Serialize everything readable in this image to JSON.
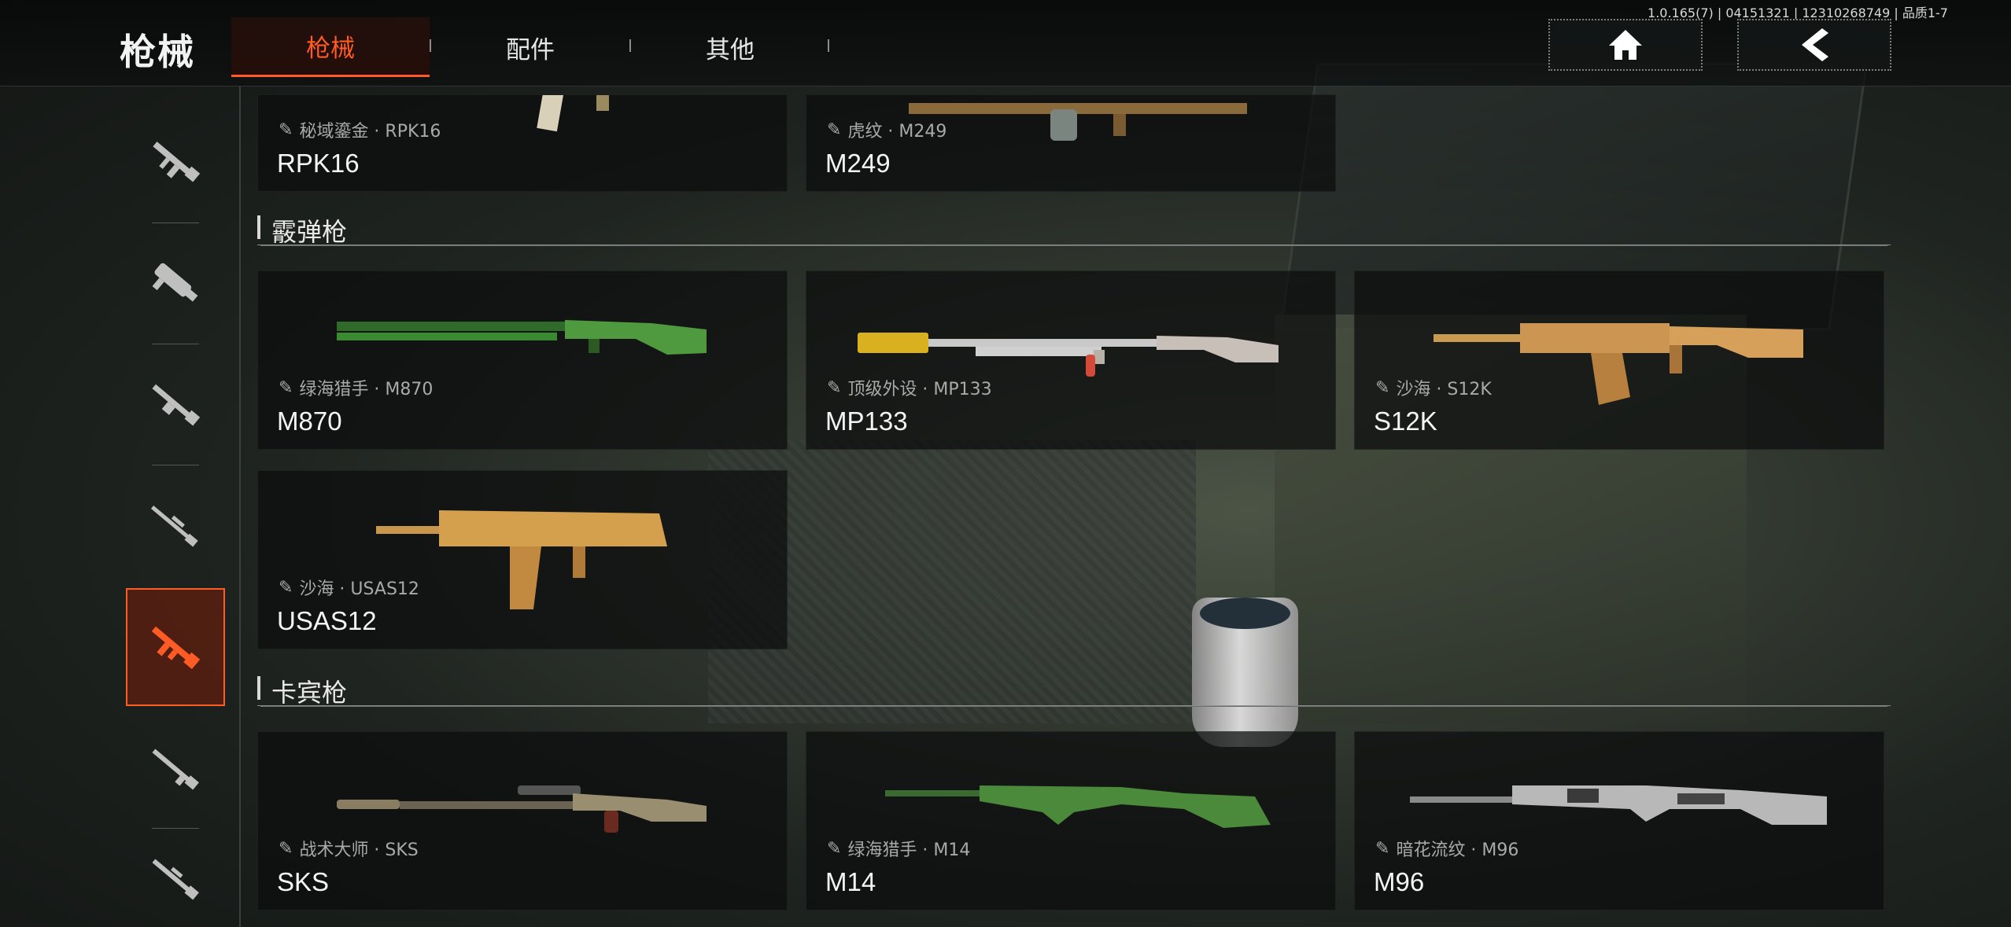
{
  "header": {
    "title": "枪械",
    "tabs": [
      {
        "label": "枪械",
        "active": true
      },
      {
        "label": "配件",
        "active": false
      },
      {
        "label": "其他",
        "active": false
      }
    ],
    "version": "1.0.165(7) | 04151321 | 12310268749 | 品质1-7",
    "home_icon": "home-icon",
    "back_icon": "back-arrow-icon"
  },
  "sidebar": {
    "categories": [
      {
        "icon": "assault-rifle-icon",
        "active": false
      },
      {
        "icon": "smg-icon",
        "active": false
      },
      {
        "icon": "lmg-icon",
        "active": false
      },
      {
        "icon": "sniper-icon",
        "active": false
      },
      {
        "icon": "shotgun-icon",
        "active": true
      },
      {
        "icon": "carbine-icon",
        "active": false
      },
      {
        "icon": "dmr-icon",
        "active": false
      }
    ]
  },
  "top_row": [
    {
      "skin": "秘域鎏金 · RPK16",
      "name": "RPK16"
    },
    {
      "skin": "虎纹 · M249",
      "name": "M249"
    }
  ],
  "sections": [
    {
      "title": "霰弹枪",
      "items": [
        {
          "skin": "绿海猎手 · M870",
          "name": "M870",
          "camo": "green"
        },
        {
          "skin": "顶级外设 · MP133",
          "name": "MP133",
          "camo": "silver"
        },
        {
          "skin": "沙海 · S12K",
          "name": "S12K",
          "camo": "sand"
        },
        {
          "skin": "沙海 · USAS12",
          "name": "USAS12",
          "camo": "sand"
        }
      ]
    },
    {
      "title": "卡宾枪",
      "items": [
        {
          "skin": "战术大师 · SKS",
          "name": "SKS",
          "camo": "tan"
        },
        {
          "skin": "绿海猎手 · M14",
          "name": "M14",
          "camo": "green"
        },
        {
          "skin": "暗花流纹 · M96",
          "name": "M96",
          "camo": "dark"
        }
      ]
    }
  ],
  "colors": {
    "accent": "#ff5b24",
    "card_bg": "#0c0e0e",
    "text": "#f5f5f5",
    "skin_text": "#a9a9a9"
  }
}
